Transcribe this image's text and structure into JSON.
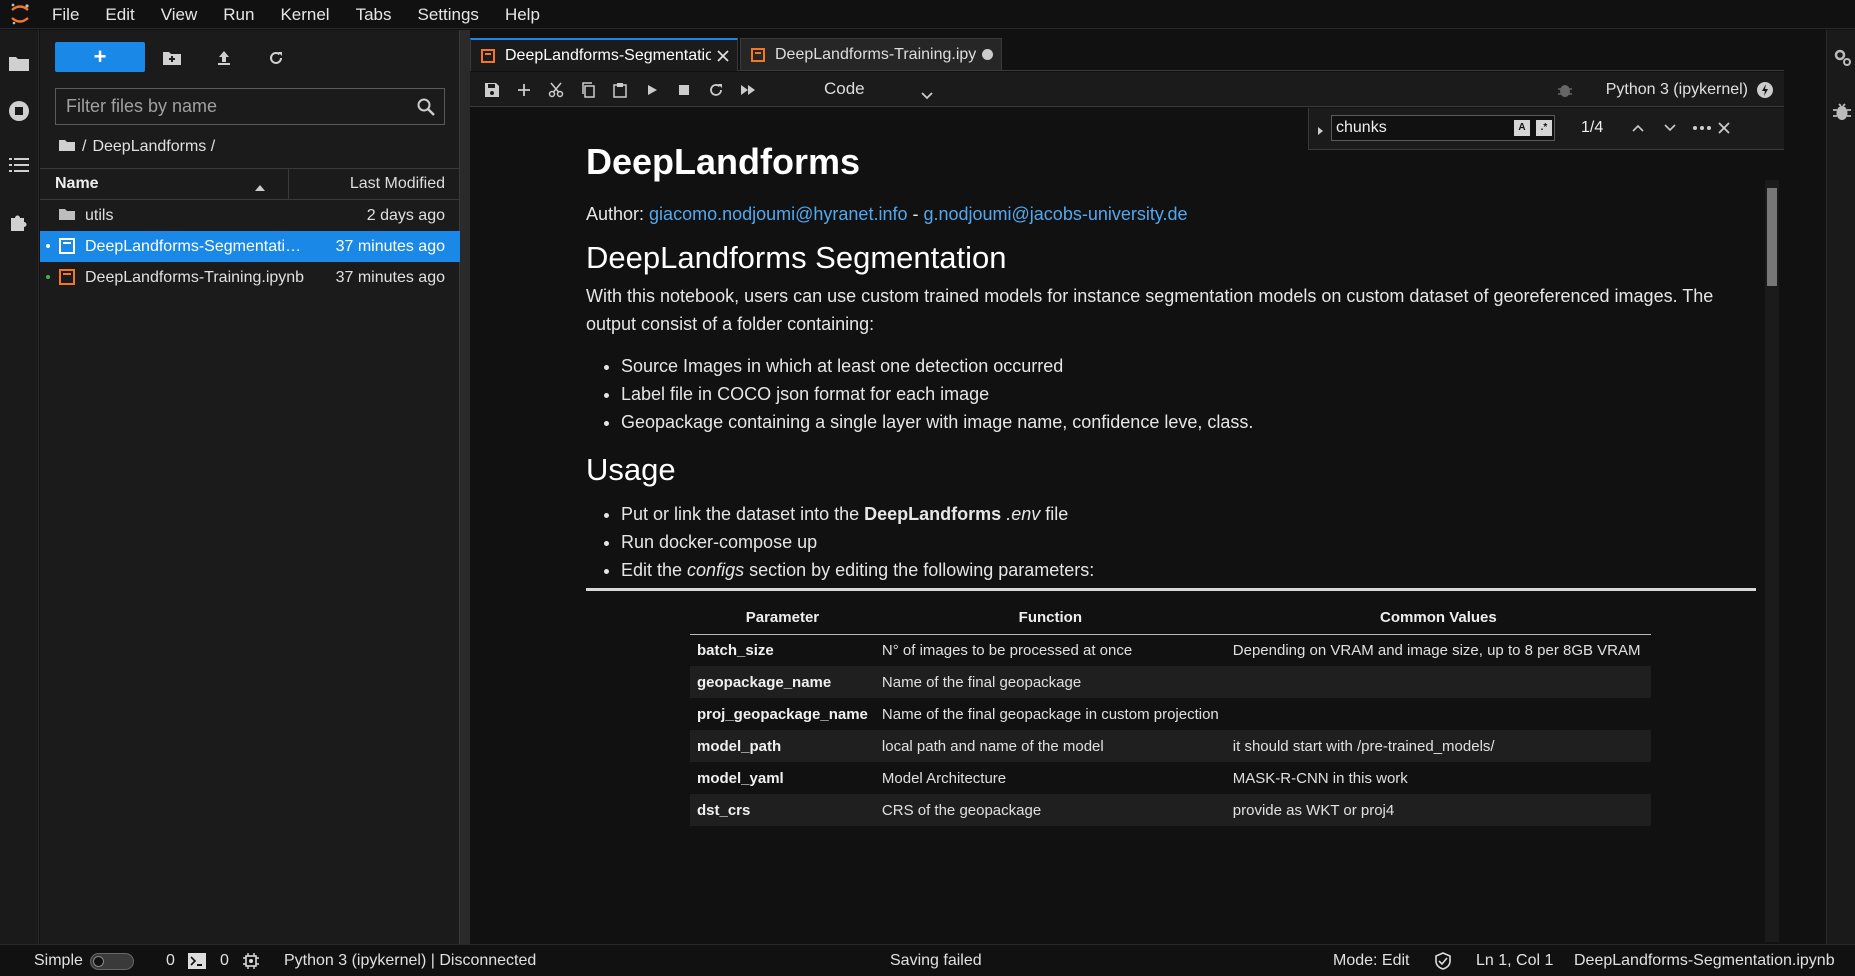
{
  "menu": [
    "File",
    "Edit",
    "View",
    "Run",
    "Kernel",
    "Tabs",
    "Settings",
    "Help"
  ],
  "filebrowser": {
    "filter_placeholder": "Filter files by name",
    "breadcrumb_sep": "/",
    "breadcrumb_path": "DeepLandforms /",
    "col_name": "Name",
    "col_modified": "Last Modified",
    "files": [
      {
        "name": "utils",
        "modified": "2 days ago",
        "type": "folder",
        "selected": false
      },
      {
        "name": "DeepLandforms-Segmentation.ipynb",
        "modified": "37 minutes ago",
        "type": "notebook",
        "selected": true
      },
      {
        "name": "DeepLandforms-Training.ipynb",
        "modified": "37 minutes ago",
        "type": "notebook",
        "selected": false
      }
    ]
  },
  "tabs": [
    {
      "label": "DeepLandforms-Segmentation.ipynb",
      "active": true
    },
    {
      "label": "DeepLandforms-Training.ipy",
      "active": false
    }
  ],
  "toolbar": {
    "cell_type": "Code",
    "kernel": "Python 3 (ipykernel)"
  },
  "search": {
    "query": "chunks",
    "case_toggle": "A",
    "regex_toggle": ".*",
    "count": "1/4"
  },
  "doc": {
    "title": "DeepLandforms",
    "author_label": "Author: ",
    "email1": "giacomo.nodjoumi@hyranet.info",
    "author_sep": " - ",
    "email2": "g.nodjoumi@jacobs-university.de",
    "seg_heading": "DeepLandforms Segmentation",
    "intro": "With this notebook, users can use custom trained models for instance segmentation models on custom dataset of georeferenced images. The output consist of a folder containing:",
    "outputs": [
      "Source Images in which at least one detection occurred",
      "Label file in COCO json format for each image",
      "Geopackage containing a single layer with image name, confidence leve, class."
    ],
    "usage_heading": "Usage",
    "usage1_pre": "Put or link the dataset into the ",
    "usage1_bold": "DeepLandforms",
    "usage1_mid": " ",
    "usage1_em": ".env",
    "usage1_post": " file",
    "usage2": "Run docker-compose up",
    "usage3_pre": "Edit the ",
    "usage3_em": "configs",
    "usage3_post": " section by editing the following parameters:",
    "table_headers": [
      "Parameter",
      "Function",
      "Common Values"
    ],
    "table_rows": [
      [
        "batch_size",
        "N° of images to be processed at once",
        "Depending on VRAM and image size, up to 8 per 8GB VRAM"
      ],
      [
        "geopackage_name",
        "Name of the final geopackage",
        ""
      ],
      [
        "proj_geopackage_name",
        "Name of the final geopackage in custom projection",
        ""
      ],
      [
        "model_path",
        "local path and name of the model",
        "it should start with /pre-trained_models/"
      ],
      [
        "model_yaml",
        "Model Architecture",
        "MASK-R-CNN in this work"
      ],
      [
        "dst_crs",
        "CRS of the geopackage",
        "provide as WKT or proj4"
      ]
    ]
  },
  "status": {
    "mode_simple": "Simple",
    "terminals": "0",
    "kernels": "0",
    "kernel_status": "Python 3 (ipykernel) | Disconnected",
    "save_status": "Saving failed",
    "mode": "Mode: Edit",
    "cursor": "Ln 1, Col 1",
    "filename": "DeepLandforms-Segmentation.ipynb"
  },
  "colors": {
    "accent": "#1a88e6",
    "link": "#52a8ee",
    "notebook_icon": "#f37726",
    "background": "#111111"
  }
}
